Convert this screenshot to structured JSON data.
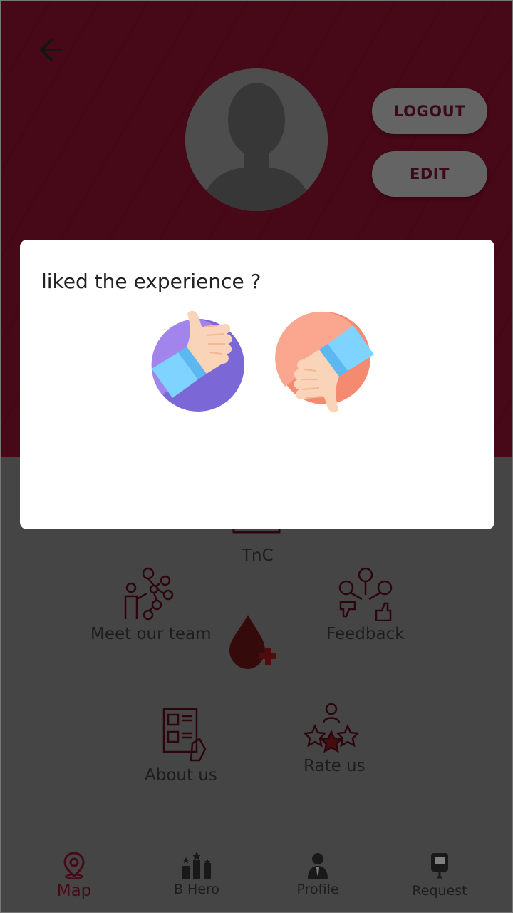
{
  "profile": {
    "logout_label": "LOGOUT",
    "edit_label": "EDIT"
  },
  "menu": {
    "tnc": "TnC",
    "meet_team": "Meet our team",
    "feedback": "Feedback",
    "about": "About us",
    "rate": "Rate us"
  },
  "nav": {
    "items": [
      {
        "label": "Map",
        "icon": "map-pin-icon",
        "active": true
      },
      {
        "label": "B Hero",
        "icon": "leaderboard-icon",
        "active": false
      },
      {
        "label": "Profile",
        "icon": "person-icon",
        "active": false
      },
      {
        "label": "Request",
        "icon": "blood-bag-icon",
        "active": false
      }
    ]
  },
  "dialog": {
    "title": "liked the experience ?",
    "options": [
      "thumbs-up-icon",
      "thumbs-down-icon"
    ]
  },
  "colors": {
    "brand": "#8e1030",
    "thumb_up_bg": "#9b7fe0",
    "thumb_down_bg": "#f48a70",
    "sleeve": "#7fd3ff",
    "skin": "#fad4b8"
  }
}
